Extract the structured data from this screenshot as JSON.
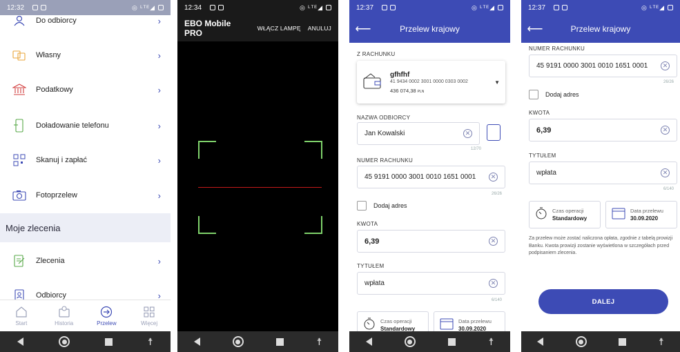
{
  "colors": {
    "primary": "#3d4bb5",
    "scanCorner": "#7fd26b",
    "scanLine": "#c51a1a"
  },
  "screen1": {
    "status": {
      "time": "12:32",
      "icons": "◎ ᴸᵀᴱ◢"
    },
    "menu_items": [
      {
        "label": "Do odbiorcy",
        "icon": "person-transfer-icon"
      },
      {
        "label": "Własny",
        "icon": "own-transfer-icon"
      },
      {
        "label": "Podatkowy",
        "icon": "tax-building-icon"
      },
      {
        "label": "Doładowanie telefonu",
        "icon": "phone-topup-icon"
      },
      {
        "label": "Skanuj i zapłać",
        "icon": "qr-scan-icon"
      },
      {
        "label": "Fotoprzelew",
        "icon": "camera-icon"
      }
    ],
    "section_title": "Moje zlecenia",
    "orders_items": [
      {
        "label": "Zlecenia",
        "icon": "orders-icon"
      },
      {
        "label": "Odbiorcy",
        "icon": "recipients-icon"
      }
    ],
    "tabs": [
      {
        "label": "Start",
        "icon": "home-icon"
      },
      {
        "label": "Historia",
        "icon": "history-icon"
      },
      {
        "label": "Przelew",
        "icon": "transfer-icon"
      },
      {
        "label": "Więcej",
        "icon": "grid-icon"
      }
    ]
  },
  "screen2": {
    "status": {
      "time": "12:34",
      "icons": "◎ ᴸᵀᴱ◢"
    },
    "title": "EBO Mobile PRO",
    "action_flash": "WŁĄCZ LAMPĘ",
    "action_cancel": "ANULUJ"
  },
  "screen3": {
    "status": {
      "time": "12:37",
      "icons": "◎ ᴸᵀᴱ◢"
    },
    "title": "Przelew krajowy",
    "from_label": "Z RACHUNKU",
    "account": {
      "name": "gfhfhf",
      "number": "41 9434 0002 3001 0000 0303 0002",
      "balance": "436 074,38",
      "currency": "PLN"
    },
    "recipient_label": "NAZWA ODBIORCY",
    "recipient_value": "Jan Kowalski",
    "recipient_counter": "12/70",
    "account_label": "NUMER RACHUNKU",
    "account_value": "45 9191 0000 3001 0010 1651 0001",
    "account_counter": "26/26",
    "add_address": "Dodaj adres",
    "amount_label": "KWOTA",
    "amount_value": "6,39",
    "title_label": "TYTUŁEM",
    "title_value": "wpłata",
    "title_counter": "6/140",
    "time_label": "Czas operacji",
    "time_value": "Standardowy",
    "date_label": "Data przelewu",
    "date_value": "30.09.2020"
  },
  "screen4": {
    "status": {
      "time": "12:37",
      "icons": "◎ ᴸᵀᴱ◢"
    },
    "title": "Przelew krajowy",
    "account_label": "NUMER RACHUNKU",
    "account_value": "45 9191 0000 3001 0010 1651 0001",
    "account_counter": "26/26",
    "add_address": "Dodaj adres",
    "amount_label": "KWOTA",
    "amount_value": "6,39",
    "title_label": "TYTUŁEM",
    "title_value": "wpłata",
    "title_counter": "6/140",
    "time_label": "Czas operacji",
    "time_value": "Standardowy",
    "date_label": "Data przelewu",
    "date_value": "30.09.2020",
    "note": "Za przelew może zostać naliczona opłata, zgodnie z tabelą prowizji Banku. Kwota prowizji zostanie wyświetlona w szczegółach przed podpisaniem zlecenia.",
    "next_button": "DALEJ"
  }
}
